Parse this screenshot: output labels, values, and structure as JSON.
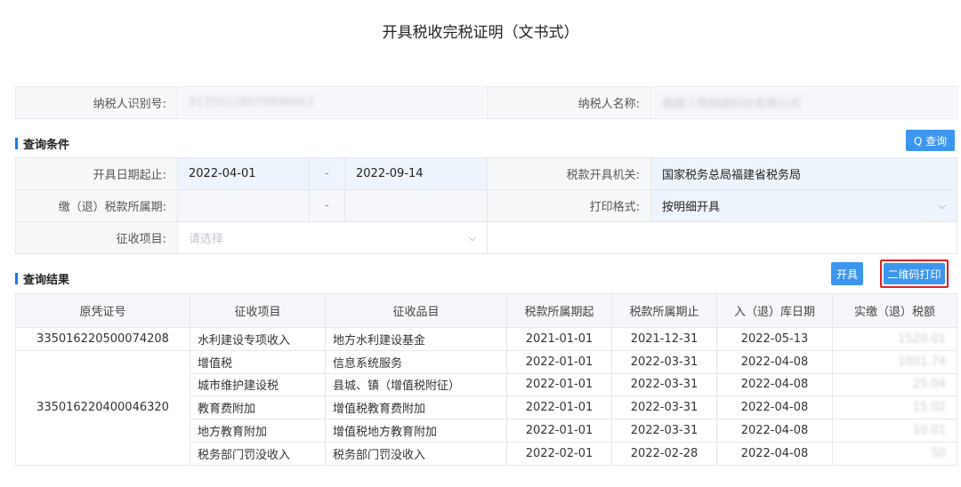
{
  "page": {
    "title": "开具税收完税证明（文书式）"
  },
  "taxpayer": {
    "id_label": "纳税人识别号:",
    "id_value": "91350128070896663",
    "name_label": "纳税人名称:",
    "name_value": "福建三带网络科技有限公司"
  },
  "query": {
    "section_title": "查询条件",
    "query_button": "Q 查询",
    "date_label": "开具日期起止:",
    "date_start": "2022-04-01",
    "date_sep": "-",
    "date_end": "2022-09-14",
    "authority_label": "税款开具机关:",
    "authority_value": "国家税务总局福建省税务局",
    "period_label": "缴（退）税款所属期:",
    "period_sep": "-",
    "print_format_label": "打印格式:",
    "print_format_value": "按明细开具",
    "item_label": "征收项目:",
    "item_placeholder": "请选择"
  },
  "results": {
    "section_title": "查询结果",
    "issue_button": "开具",
    "qr_print_button": "二维码打印",
    "columns": [
      "原凭证号",
      "征收项目",
      "征收品目",
      "税款所属期起",
      "税款所属期止",
      "入（退）库日期",
      "实缴（退）税额"
    ],
    "groups": [
      {
        "cert_no": "335016220500074208",
        "rows": [
          {
            "item": "水利建设专项收入",
            "sub_item": "地方水利建设基金",
            "period_start": "2021-01-01",
            "period_end": "2021-12-31",
            "storage_date": "2022-05-13",
            "amount": "1520.01"
          }
        ]
      },
      {
        "cert_no": "335016220400046320",
        "rows": [
          {
            "item": "增值税",
            "sub_item": "信息系统服务",
            "period_start": "2022-01-01",
            "period_end": "2022-03-31",
            "storage_date": "2022-04-08",
            "amount": "1001.74"
          },
          {
            "item": "城市维护建设税",
            "sub_item": "县城、镇（增值税附征）",
            "period_start": "2022-01-01",
            "period_end": "2022-03-31",
            "storage_date": "2022-04-08",
            "amount": "25.04"
          },
          {
            "item": "教育费附加",
            "sub_item": "增值税教育费附加",
            "period_start": "2022-01-01",
            "period_end": "2022-03-31",
            "storage_date": "2022-04-08",
            "amount": "15.02"
          },
          {
            "item": "地方教育附加",
            "sub_item": "增值税地方教育附加",
            "period_start": "2022-01-01",
            "period_end": "2022-03-31",
            "storage_date": "2022-04-08",
            "amount": "10.01"
          },
          {
            "item": "税务部门罚没收入",
            "sub_item": "税务部门罚没收入",
            "period_start": "2022-02-01",
            "period_end": "2022-02-28",
            "storage_date": "2022-04-08",
            "amount": "50"
          }
        ]
      }
    ]
  }
}
